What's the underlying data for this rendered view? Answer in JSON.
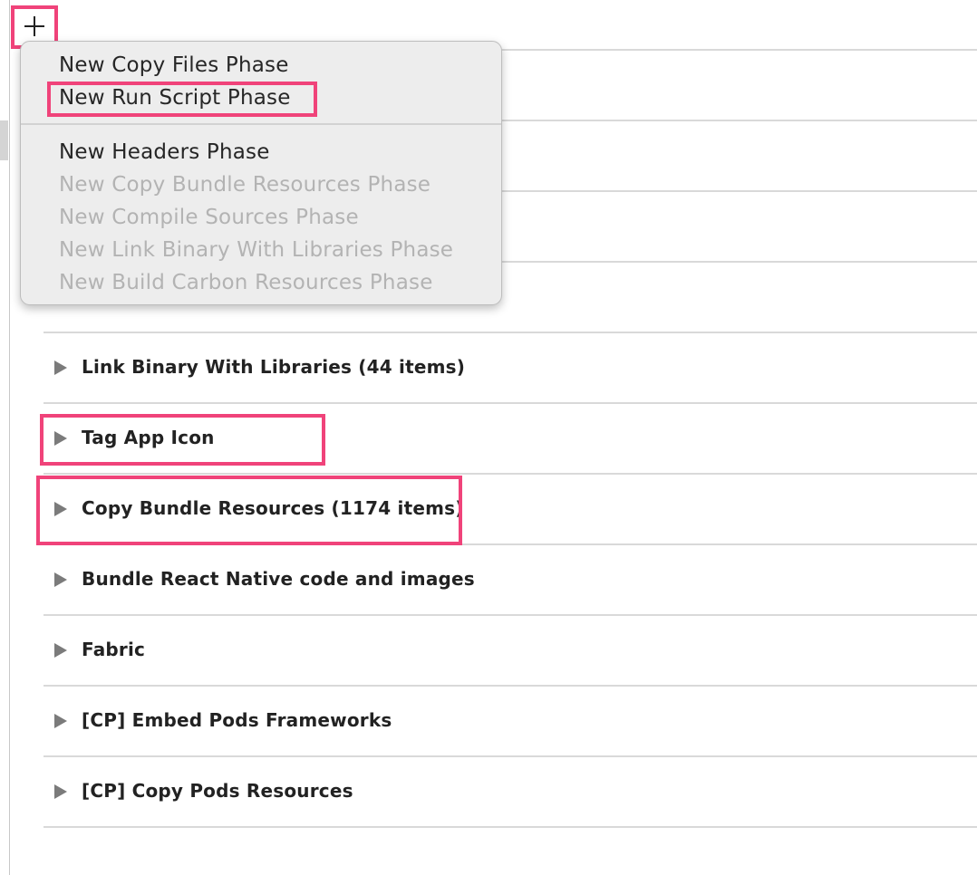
{
  "toolbar": {
    "add_button_symbol": "+"
  },
  "add_menu": {
    "items": [
      {
        "label": "New Copy Files Phase",
        "enabled": true
      },
      {
        "label": "New Run Script Phase",
        "enabled": true,
        "highlighted": true
      },
      {
        "label": "New Headers Phase",
        "enabled": true
      },
      {
        "label": "New Copy Bundle Resources Phase",
        "enabled": false
      },
      {
        "label": "New Compile Sources Phase",
        "enabled": false
      },
      {
        "label": "New Link Binary With Libraries Phase",
        "enabled": false
      },
      {
        "label": "New Build Carbon Resources Phase",
        "enabled": false
      }
    ]
  },
  "build_phases": [
    {
      "label": "Link Binary With Libraries (44 items)"
    },
    {
      "label": "Tag App Icon",
      "highlighted": true
    },
    {
      "label": "Copy Bundle Resources (1174 items)",
      "highlighted": true
    },
    {
      "label": "Bundle React Native code and images"
    },
    {
      "label": "Fabric"
    },
    {
      "label": "[CP] Embed Pods Frameworks"
    },
    {
      "label": "[CP] Copy Pods Resources"
    }
  ],
  "colors": {
    "highlight": "#f0437a",
    "menu_background": "#ededed",
    "disabled_text": "#b3b3b3"
  }
}
